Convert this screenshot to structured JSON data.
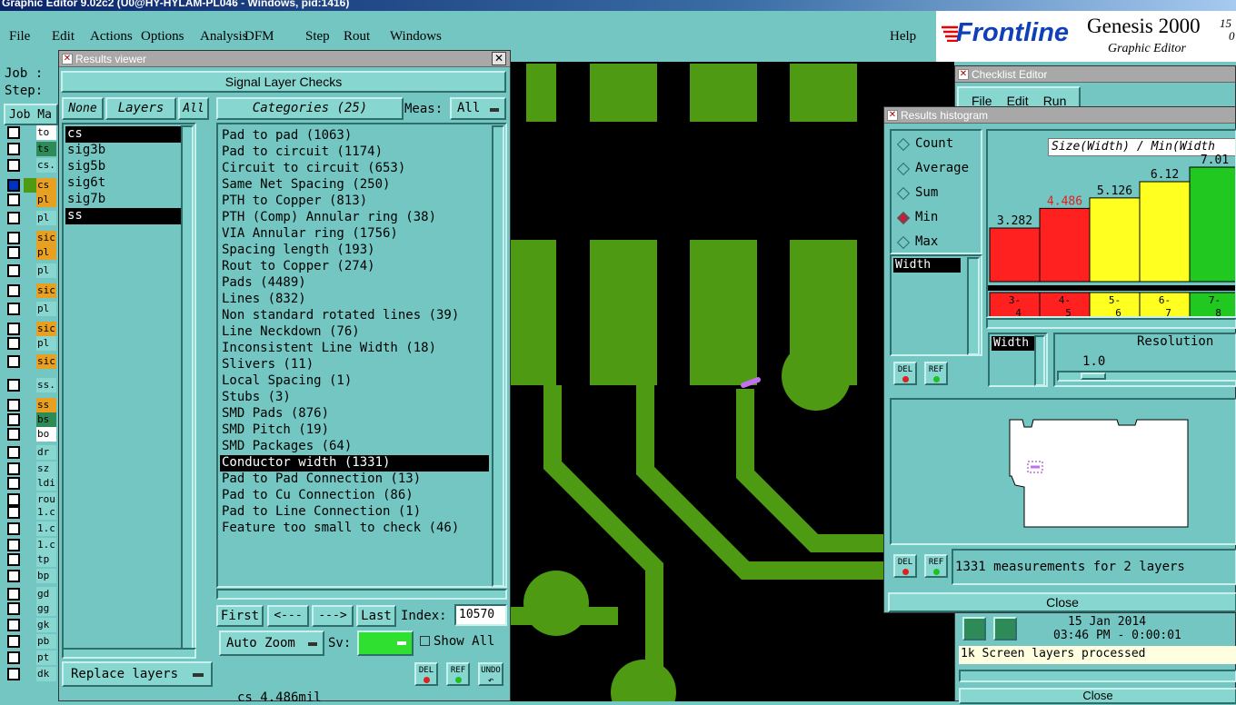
{
  "app": {
    "title": "Graphic Editor 9.02c2 (U0@HY-HYLAM-PL046 - Windows, pid:1416)"
  },
  "menu": [
    "File",
    "Edit",
    "Actions",
    "Options",
    "Analysis",
    "DFM",
    "Step",
    "Rout",
    "Windows"
  ],
  "help": "Help",
  "brand": {
    "logo": "Frontline",
    "product": "Genesis 2000",
    "version_top": "15",
    "version_bottom": "0",
    "subtitle": "Graphic Editor"
  },
  "main_left": {
    "job_label": "Job :",
    "step_label": "Step:",
    "job_manager": "Job Ma"
  },
  "layer_list": [
    {
      "name": "to",
      "color": "#ffffff"
    },
    {
      "name": "ts",
      "color": "#2e8b57"
    },
    {
      "name": "cs.",
      "color": "#88d6d0"
    },
    {
      "name": "cs",
      "color": "#e8a020",
      "active": true
    },
    {
      "name": "pl",
      "color": "#e8a020"
    },
    {
      "name": "pl",
      "color": "#88d6d0"
    },
    {
      "name": "sic",
      "color": "#e8a020"
    },
    {
      "name": "pl",
      "color": "#e8a020"
    },
    {
      "name": "pl",
      "color": "#88d6d0"
    },
    {
      "name": "sic",
      "color": "#e8a020"
    },
    {
      "name": "pl",
      "color": "#88d6d0"
    },
    {
      "name": "sic",
      "color": "#e8a020"
    },
    {
      "name": "pl",
      "color": "#88d6d0"
    },
    {
      "name": "sic",
      "color": "#e8a020"
    },
    {
      "name": "ss.",
      "color": "#88d6d0"
    },
    {
      "name": "ss",
      "color": "#e8a020"
    },
    {
      "name": "bs",
      "color": "#2e8b57"
    },
    {
      "name": "bo",
      "color": "#ffffff"
    },
    {
      "name": "dr",
      "color": "#88d6d0"
    },
    {
      "name": "sz",
      "color": "#88d6d0"
    },
    {
      "name": "ldi",
      "color": "#88d6d0"
    },
    {
      "name": "rou",
      "color": "#88d6d0"
    },
    {
      "name": "1.c",
      "color": "#88d6d0"
    },
    {
      "name": "1.c",
      "color": "#88d6d0"
    },
    {
      "name": "1.c",
      "color": "#88d6d0"
    },
    {
      "name": "tp",
      "color": "#88d6d0"
    },
    {
      "name": "bp",
      "color": "#88d6d0"
    },
    {
      "name": "gd",
      "color": "#88d6d0"
    },
    {
      "name": "gg",
      "color": "#88d6d0"
    },
    {
      "name": "gk",
      "color": "#88d6d0"
    },
    {
      "name": "pb",
      "color": "#88d6d0"
    },
    {
      "name": "pt",
      "color": "#88d6d0"
    },
    {
      "name": "dk",
      "color": "#88d6d0"
    }
  ],
  "results_viewer": {
    "title": "Results viewer",
    "heading": "Signal Layer Checks",
    "none_btn": "None",
    "layers_btn": "Layers",
    "all_btn": "All",
    "categories_btn": "Categories (25)",
    "meas_label": "Meas:",
    "meas_value": "All",
    "layers": [
      "cs",
      "sig3b",
      "sig5b",
      "sig6t",
      "sig7b",
      "ss"
    ],
    "categories": [
      "Pad to pad (1063)",
      "Pad to circuit (1174)",
      "Circuit to circuit (653)",
      "Same Net Spacing (250)",
      "PTH to Copper (813)",
      "PTH (Comp) Annular ring (38)",
      "VIA Annular ring (1756)",
      "Spacing length (193)",
      "Rout to Copper (274)",
      "Pads (4489)",
      "Lines (832)",
      "Non standard rotated lines (39)",
      "Line Neckdown (76)",
      "Inconsistent Line Width (18)",
      "Slivers (11)",
      "Local Spacing (1)",
      "Stubs (3)",
      "SMD Pads (876)",
      "SMD Pitch (19)",
      "SMD Packages (64)",
      "Conductor width (1331)",
      "Pad to Pad Connection (13)",
      "Pad to Cu Connection (86)",
      "Pad to Line Connection (1)",
      "Feature too small to check (46)"
    ],
    "selected_category": "Conductor width (1331)",
    "first": "First",
    "prev": "<---",
    "next": "--->",
    "last": "Last",
    "index_label": "Index:",
    "index_value": "10570",
    "auto_zoom": "Auto Zoom",
    "sv_label": "Sv:",
    "show_all": "Show All",
    "replace_layers": "Replace layers",
    "del": "DEL",
    "ref": "REF",
    "undo": "UNDO",
    "status": "cs 4.486mil"
  },
  "histogram": {
    "title": "Results histogram",
    "modes": [
      "Count",
      "Average",
      "Sum",
      "Min",
      "Max"
    ],
    "selected_mode": "Min",
    "chart_title": "Size(Width) / Min(Width",
    "list_item": "Width",
    "resolution_label": "Resolution",
    "resolution_value": "1.0",
    "width_item": "Width",
    "del": "DEL",
    "ref": "REF",
    "summary": "1331 measurements for 2 layers",
    "close": "Close"
  },
  "chart_data": {
    "type": "bar",
    "title": "Size(Width) / Min(Width",
    "categories": [
      "3-4",
      "4-5",
      "5-6",
      "6-7",
      "7-8"
    ],
    "values": [
      3.282,
      4.486,
      5.126,
      6.12,
      7.01
    ],
    "value_labels": [
      "3.282",
      "4.486",
      "5.126",
      "6.12",
      "7.01"
    ],
    "colors": [
      "#ff2020",
      "#ff2020",
      "#ffff20",
      "#ffff20",
      "#20c820"
    ],
    "ylim": [
      0,
      7.01
    ]
  },
  "checklist": {
    "title": "Checklist Editor",
    "menu": [
      "File",
      "Edit",
      "Run"
    ],
    "date": "15 Jan 2014",
    "time": "03:46 PM - 0:00:01",
    "message": "1k Screen layers processed",
    "close": "Close"
  }
}
